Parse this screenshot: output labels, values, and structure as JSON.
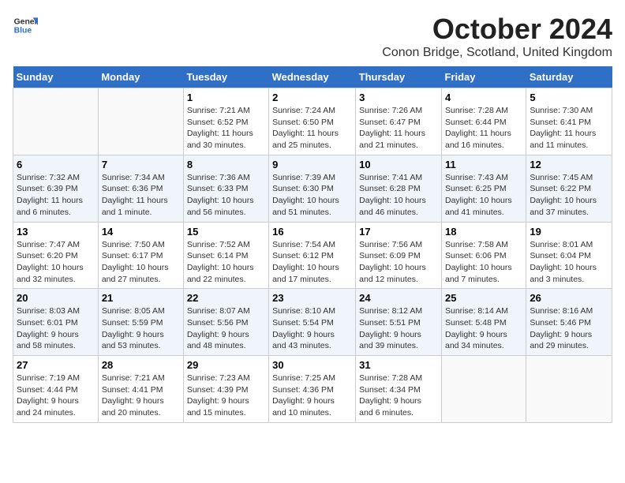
{
  "header": {
    "logo_line1": "General",
    "logo_line2": "Blue",
    "title": "October 2024",
    "location": "Conon Bridge, Scotland, United Kingdom"
  },
  "days_of_week": [
    "Sunday",
    "Monday",
    "Tuesday",
    "Wednesday",
    "Thursday",
    "Friday",
    "Saturday"
  ],
  "weeks": [
    [
      {
        "num": "",
        "info": ""
      },
      {
        "num": "",
        "info": ""
      },
      {
        "num": "1",
        "info": "Sunrise: 7:21 AM\nSunset: 6:52 PM\nDaylight: 11 hours\nand 30 minutes."
      },
      {
        "num": "2",
        "info": "Sunrise: 7:24 AM\nSunset: 6:50 PM\nDaylight: 11 hours\nand 25 minutes."
      },
      {
        "num": "3",
        "info": "Sunrise: 7:26 AM\nSunset: 6:47 PM\nDaylight: 11 hours\nand 21 minutes."
      },
      {
        "num": "4",
        "info": "Sunrise: 7:28 AM\nSunset: 6:44 PM\nDaylight: 11 hours\nand 16 minutes."
      },
      {
        "num": "5",
        "info": "Sunrise: 7:30 AM\nSunset: 6:41 PM\nDaylight: 11 hours\nand 11 minutes."
      }
    ],
    [
      {
        "num": "6",
        "info": "Sunrise: 7:32 AM\nSunset: 6:39 PM\nDaylight: 11 hours\nand 6 minutes."
      },
      {
        "num": "7",
        "info": "Sunrise: 7:34 AM\nSunset: 6:36 PM\nDaylight: 11 hours\nand 1 minute."
      },
      {
        "num": "8",
        "info": "Sunrise: 7:36 AM\nSunset: 6:33 PM\nDaylight: 10 hours\nand 56 minutes."
      },
      {
        "num": "9",
        "info": "Sunrise: 7:39 AM\nSunset: 6:30 PM\nDaylight: 10 hours\nand 51 minutes."
      },
      {
        "num": "10",
        "info": "Sunrise: 7:41 AM\nSunset: 6:28 PM\nDaylight: 10 hours\nand 46 minutes."
      },
      {
        "num": "11",
        "info": "Sunrise: 7:43 AM\nSunset: 6:25 PM\nDaylight: 10 hours\nand 41 minutes."
      },
      {
        "num": "12",
        "info": "Sunrise: 7:45 AM\nSunset: 6:22 PM\nDaylight: 10 hours\nand 37 minutes."
      }
    ],
    [
      {
        "num": "13",
        "info": "Sunrise: 7:47 AM\nSunset: 6:20 PM\nDaylight: 10 hours\nand 32 minutes."
      },
      {
        "num": "14",
        "info": "Sunrise: 7:50 AM\nSunset: 6:17 PM\nDaylight: 10 hours\nand 27 minutes."
      },
      {
        "num": "15",
        "info": "Sunrise: 7:52 AM\nSunset: 6:14 PM\nDaylight: 10 hours\nand 22 minutes."
      },
      {
        "num": "16",
        "info": "Sunrise: 7:54 AM\nSunset: 6:12 PM\nDaylight: 10 hours\nand 17 minutes."
      },
      {
        "num": "17",
        "info": "Sunrise: 7:56 AM\nSunset: 6:09 PM\nDaylight: 10 hours\nand 12 minutes."
      },
      {
        "num": "18",
        "info": "Sunrise: 7:58 AM\nSunset: 6:06 PM\nDaylight: 10 hours\nand 7 minutes."
      },
      {
        "num": "19",
        "info": "Sunrise: 8:01 AM\nSunset: 6:04 PM\nDaylight: 10 hours\nand 3 minutes."
      }
    ],
    [
      {
        "num": "20",
        "info": "Sunrise: 8:03 AM\nSunset: 6:01 PM\nDaylight: 9 hours\nand 58 minutes."
      },
      {
        "num": "21",
        "info": "Sunrise: 8:05 AM\nSunset: 5:59 PM\nDaylight: 9 hours\nand 53 minutes."
      },
      {
        "num": "22",
        "info": "Sunrise: 8:07 AM\nSunset: 5:56 PM\nDaylight: 9 hours\nand 48 minutes."
      },
      {
        "num": "23",
        "info": "Sunrise: 8:10 AM\nSunset: 5:54 PM\nDaylight: 9 hours\nand 43 minutes."
      },
      {
        "num": "24",
        "info": "Sunrise: 8:12 AM\nSunset: 5:51 PM\nDaylight: 9 hours\nand 39 minutes."
      },
      {
        "num": "25",
        "info": "Sunrise: 8:14 AM\nSunset: 5:48 PM\nDaylight: 9 hours\nand 34 minutes."
      },
      {
        "num": "26",
        "info": "Sunrise: 8:16 AM\nSunset: 5:46 PM\nDaylight: 9 hours\nand 29 minutes."
      }
    ],
    [
      {
        "num": "27",
        "info": "Sunrise: 7:19 AM\nSunset: 4:44 PM\nDaylight: 9 hours\nand 24 minutes."
      },
      {
        "num": "28",
        "info": "Sunrise: 7:21 AM\nSunset: 4:41 PM\nDaylight: 9 hours\nand 20 minutes."
      },
      {
        "num": "29",
        "info": "Sunrise: 7:23 AM\nSunset: 4:39 PM\nDaylight: 9 hours\nand 15 minutes."
      },
      {
        "num": "30",
        "info": "Sunrise: 7:25 AM\nSunset: 4:36 PM\nDaylight: 9 hours\nand 10 minutes."
      },
      {
        "num": "31",
        "info": "Sunrise: 7:28 AM\nSunset: 4:34 PM\nDaylight: 9 hours\nand 6 minutes."
      },
      {
        "num": "",
        "info": ""
      },
      {
        "num": "",
        "info": ""
      }
    ]
  ]
}
